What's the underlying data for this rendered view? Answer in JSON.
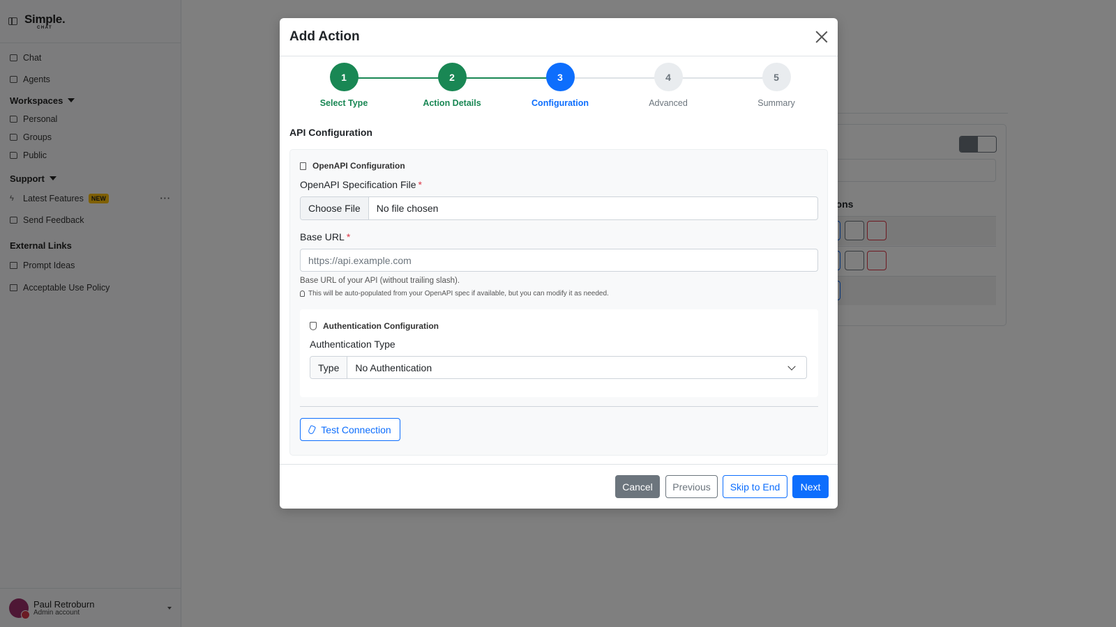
{
  "sidebar": {
    "brand": {
      "line1": "Simple.",
      "line2": "CHAT"
    },
    "items_top": [
      {
        "label": "Chat",
        "icon": "chat-icon"
      },
      {
        "label": "Agents",
        "icon": "robot-icon"
      }
    ],
    "workspaces": {
      "heading": "Workspaces",
      "items": [
        {
          "label": "Personal",
          "icon": "folder-icon"
        },
        {
          "label": "Groups",
          "icon": "folder-icon"
        },
        {
          "label": "Public",
          "icon": "folder-icon"
        }
      ]
    },
    "support": {
      "heading": "Support",
      "latest_features": "Latest Features",
      "badge": "NEW",
      "more": "···",
      "send_feedback": "Send Feedback"
    },
    "external": {
      "heading": "External Links",
      "items": [
        {
          "label": "Prompt Ideas"
        },
        {
          "label": "Acceptable Use Policy"
        }
      ]
    },
    "user": {
      "name": "Paul Retroburn",
      "role": "Admin account"
    }
  },
  "background": {
    "actions_heading": "tions"
  },
  "modal": {
    "title": "Add Action",
    "steps": [
      {
        "number": "1",
        "label": "Select Type",
        "state": "done"
      },
      {
        "number": "2",
        "label": "Action Details",
        "state": "done"
      },
      {
        "number": "3",
        "label": "Configuration",
        "state": "active"
      },
      {
        "number": "4",
        "label": "Advanced",
        "state": "todo"
      },
      {
        "number": "5",
        "label": "Summary",
        "state": "todo"
      }
    ],
    "section_title": "API Configuration",
    "openapi": {
      "heading": "OpenAPI Configuration",
      "spec_label": "OpenAPI Specification File",
      "required_mark": "*",
      "choose_file": "Choose File",
      "no_file": "No file chosen"
    },
    "base_url": {
      "label": "Base URL",
      "required_mark": "*",
      "placeholder": "https://api.example.com",
      "help": "Base URL of your API (without trailing slash).",
      "hint": "This will be auto-populated from your OpenAPI spec if available, but you can modify it as needed."
    },
    "auth": {
      "heading": "Authentication Configuration",
      "type_label": "Authentication Type",
      "addon": "Type",
      "selected": "No Authentication"
    },
    "test_connection": "Test Connection",
    "footer": {
      "cancel": "Cancel",
      "previous": "Previous",
      "skip": "Skip to End",
      "next": "Next"
    }
  },
  "colors": {
    "primary": "#0d6efd",
    "success": "#198754",
    "secondary": "#6c757d",
    "danger": "#dc3545",
    "badge": "#ffc107"
  }
}
